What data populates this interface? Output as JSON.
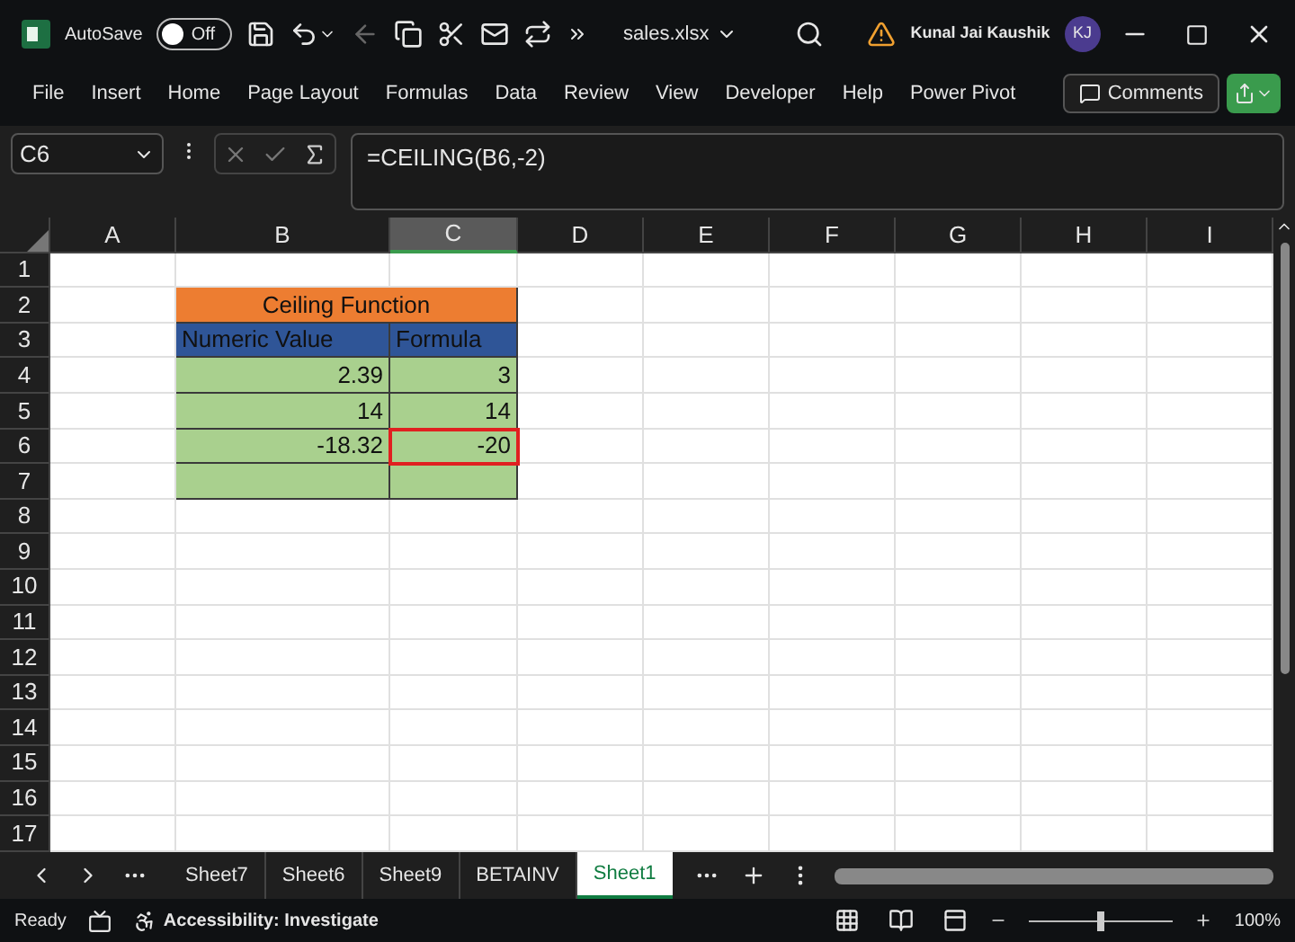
{
  "title_bar": {
    "autosave_label": "AutoSave",
    "autosave_toggle": {
      "label": "Off",
      "on": false
    },
    "file_name": "sales.xlsx",
    "user_name": "Kunal Jai Kaushik",
    "user_initials": "KJ"
  },
  "ribbon_tabs": [
    "File",
    "Insert",
    "Home",
    "Page Layout",
    "Formulas",
    "Data",
    "Review",
    "View",
    "Developer",
    "Help",
    "Power Pivot"
  ],
  "comments_button": "Comments",
  "formula_bar": {
    "name_box": "C6",
    "formula": "=CEILING(B6,-2)"
  },
  "sheet": {
    "columns": [
      {
        "label": "A",
        "selected": false
      },
      {
        "label": "B",
        "selected": false
      },
      {
        "label": "C",
        "selected": true
      },
      {
        "label": "D",
        "selected": false
      },
      {
        "label": "E",
        "selected": false
      },
      {
        "label": "F",
        "selected": false
      },
      {
        "label": "G",
        "selected": false
      },
      {
        "label": "H",
        "selected": false
      },
      {
        "label": "I",
        "selected": false
      }
    ],
    "rows": [
      {
        "label": "1"
      },
      {
        "label": "2",
        "cells": [
          {
            "kind": "empty"
          },
          {
            "kind": "merged",
            "text": "Ceiling Function",
            "color": "#ed7d31",
            "active": false
          }
        ]
      },
      {
        "label": "3",
        "cells": [
          {
            "kind": "empty"
          },
          {
            "kind": "text",
            "text": "Numeric Value",
            "color": "#2f5597",
            "active": false
          },
          {
            "kind": "text",
            "text": "Formula",
            "color": "#2f5597",
            "active": false
          }
        ]
      },
      {
        "label": "4",
        "cells": [
          {
            "kind": "empty"
          },
          {
            "kind": "number",
            "text": "2.39",
            "color": "#a9d08e",
            "active": false
          },
          {
            "kind": "number",
            "text": "3",
            "color": "#a9d08e",
            "active": false
          }
        ]
      },
      {
        "label": "5",
        "cells": [
          {
            "kind": "empty"
          },
          {
            "kind": "number",
            "text": "14",
            "color": "#a9d08e",
            "active": false
          },
          {
            "kind": "number",
            "text": "14",
            "color": "#a9d08e",
            "active": false
          }
        ]
      },
      {
        "label": "6",
        "cells": [
          {
            "kind": "empty"
          },
          {
            "kind": "number",
            "text": "-18.32",
            "color": "#a9d08e",
            "active": false
          },
          {
            "kind": "number",
            "text": "-20",
            "color": "#a9d08e",
            "active": true
          }
        ]
      },
      {
        "label": "7",
        "cells": [
          {
            "kind": "empty"
          },
          {
            "kind": "number",
            "color": "#a9d08e",
            "active": false
          },
          {
            "kind": "number",
            "color": "#a9d08e",
            "active": false
          }
        ]
      },
      {
        "label": "8"
      },
      {
        "label": "9"
      },
      {
        "label": "10"
      },
      {
        "label": "11"
      },
      {
        "label": "12"
      },
      {
        "label": "13"
      },
      {
        "label": "14"
      },
      {
        "label": "15"
      },
      {
        "label": "16"
      },
      {
        "label": "17"
      }
    ]
  },
  "sheet_tabs": [
    {
      "label": "Sheet7",
      "selected": false
    },
    {
      "label": "Sheet6",
      "selected": false
    },
    {
      "label": "Sheet9",
      "selected": false
    },
    {
      "label": "BETAINV",
      "selected": false
    },
    {
      "label": "Sheet1",
      "selected": true
    }
  ],
  "status_bar": {
    "ready": "Ready",
    "accessibility": "Accessibility: Investigate",
    "zoom": {
      "level": 0.5
    },
    "zoom_percent": "100%"
  }
}
